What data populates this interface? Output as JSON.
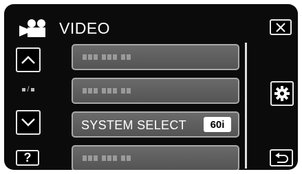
{
  "header": {
    "title": "VIDEO",
    "icon": "video-camera-icon"
  },
  "nav": {
    "close_icon": "close-icon",
    "up_icon": "chevron-up-icon",
    "down_icon": "chevron-down-icon",
    "help_label": "?",
    "settings_icon": "gear-icon",
    "back_icon": "return-icon",
    "page_indicator": "page-indicator"
  },
  "menu": {
    "items": [
      {
        "label": "",
        "value": "",
        "state": "placeholder"
      },
      {
        "label": "",
        "value": "",
        "state": "placeholder"
      },
      {
        "label": "SYSTEM SELECT",
        "value": "60i",
        "state": "active"
      },
      {
        "label": "",
        "value": "",
        "state": "placeholder"
      }
    ]
  },
  "colors": {
    "background": "#0b0b0b",
    "item": "#5e5e5e",
    "border": "#a9a9a9",
    "text": "#ffffff"
  }
}
